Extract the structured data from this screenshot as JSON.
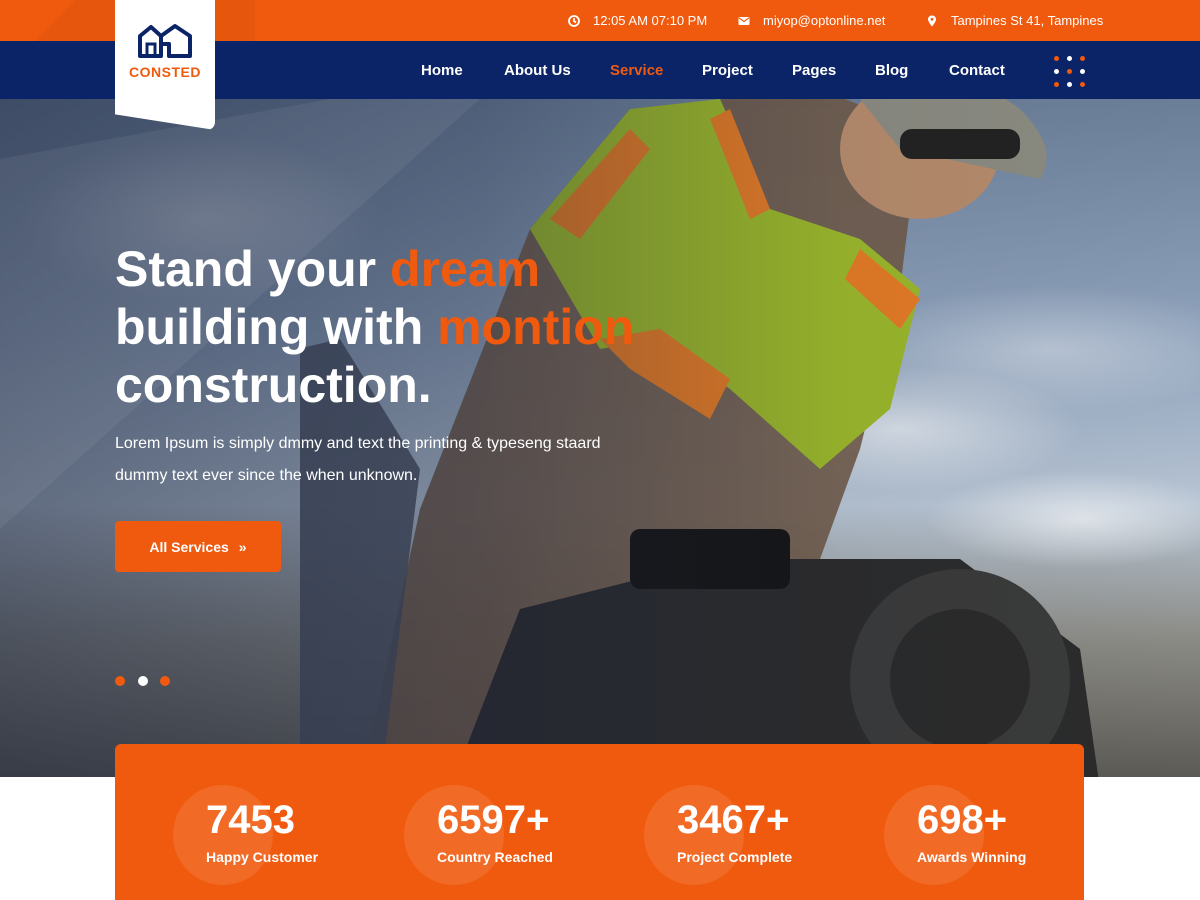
{
  "brand": {
    "name": "CONSTED",
    "logo_icon": "house-outline-icon"
  },
  "topbar": {
    "time": "12:05 AM 07:10 PM",
    "email": "miyop@optonline.net",
    "address": "Tampines St 41, Tampines"
  },
  "nav": {
    "items": [
      "Home",
      "About Us",
      "Service",
      "Project",
      "Pages",
      "Blog",
      "Contact"
    ],
    "active": "Service"
  },
  "hero": {
    "title_line1_a": "Stand your ",
    "title_line1_b": "dream",
    "title_line2_a": "building with ",
    "title_line2_b": "montion",
    "title_line3": "construction.",
    "description_line1": "Lorem Ipsum is simply dmmy and text the printing & typeseng staard",
    "description_line2": "dummy text ever since the when unknown.",
    "button_label": "All Services",
    "button_arrow": "»",
    "slider_active_index": 1,
    "slider_count": 3
  },
  "stats": [
    {
      "value": "7453",
      "label": "Happy Customer"
    },
    {
      "value": "6597+",
      "label": "Country Reached"
    },
    {
      "value": "3467+",
      "label": "Project Complete"
    },
    {
      "value": "698+",
      "label": "Awards Winning"
    }
  ],
  "colors": {
    "accent": "#f05a0e",
    "navy": "#0a2467",
    "white": "#ffffff"
  }
}
